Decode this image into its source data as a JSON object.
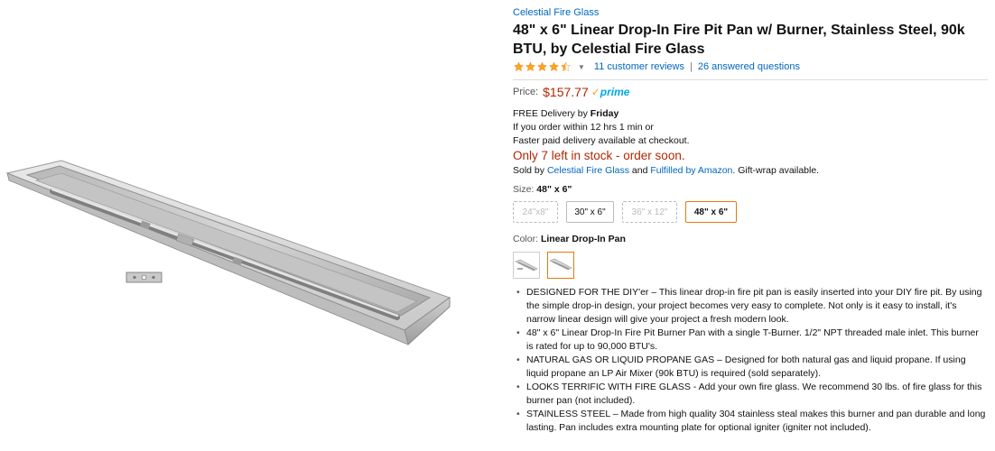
{
  "brand_link": "Celestial Fire Glass",
  "title": "48\" x 6\" Linear Drop-In Fire Pit Pan w/ Burner, Stainless Steel, 90k BTU, by Celestial Fire Glass",
  "rating": {
    "stars": 4.5,
    "reviews_link": "11 customer reviews",
    "separator": "|",
    "questions_link": "26 answered questions"
  },
  "price": {
    "label": "Price:",
    "value": "$157.77",
    "prime_check": "✓",
    "prime_label": "prime"
  },
  "delivery": {
    "free_text": "FREE Delivery by ",
    "day": "Friday",
    "order_within": "If you order within 12 hrs 1 min or",
    "faster": "Faster paid delivery available at checkout."
  },
  "stock_message": "Only 7 left in stock - order soon.",
  "sold_by": {
    "prefix": "Sold by ",
    "seller": "Celestial Fire Glass",
    "and": " and ",
    "fulfilled": "Fulfilled by Amazon",
    "suffix": ". Gift-wrap available."
  },
  "size": {
    "label": "Size: ",
    "selected": "48\" x 6\"",
    "options": [
      {
        "label": "24\"x8\"",
        "state": "unavailable"
      },
      {
        "label": "30\" x 6\"",
        "state": "normal"
      },
      {
        "label": "36\" x 12\"",
        "state": "unavailable"
      },
      {
        "label": "48\" x 6\"",
        "state": "selected"
      }
    ]
  },
  "color": {
    "label": "Color: ",
    "selected": "Linear Drop-In Pan"
  },
  "bullets": [
    "DESIGNED FOR THE DIY'er – This linear drop-in fire pit pan is easily inserted into your DIY fire pit. By using the simple drop-in design, your project becomes very easy to complete. Not only is it easy to install, it's narrow linear design will give your project a fresh modern look.",
    "48\" x 6\" Linear Drop-In Fire Pit Burner Pan with a single T-Burner. 1/2\" NPT threaded male inlet. This burner is rated for up to 90,000 BTU's.",
    "NATURAL GAS OR LIQUID PROPANE GAS – Designed for both natural gas and liquid propane. If using liquid propane an LP Air Mixer (90k BTU) is required (sold separately).",
    "LOOKS TERRIFIC WITH FIRE GLASS - Add your own fire glass. We recommend 30 lbs. of fire glass for this burner pan (not included).",
    "STAINLESS STEEL – Made from high quality 304 stainless steal makes this burner and pan durable and long lasting. Pan includes extra mounting plate for optional igniter (igniter not included)."
  ],
  "colors": {
    "link": "#0066c0",
    "price": "#b12704",
    "prime": "#00a8e1",
    "star": "#ffa41c",
    "selected_border": "#e47911"
  }
}
